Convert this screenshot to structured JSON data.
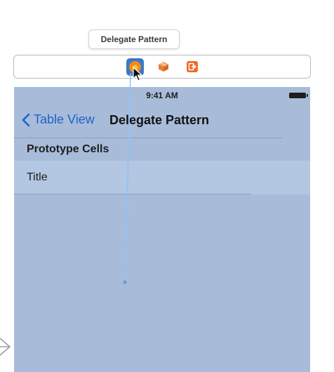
{
  "tooltip": {
    "text": "Delegate Pattern"
  },
  "dock": {
    "icons": [
      "view-controller-icon",
      "first-responder-icon",
      "exit-icon"
    ]
  },
  "status_bar": {
    "time": "9:41 AM"
  },
  "nav_bar": {
    "back_label": "Table View",
    "title": "Delegate Pattern"
  },
  "table": {
    "section_header": "Prototype Cells",
    "cell_title": "Title"
  },
  "colors": {
    "scene_background": "#a8bcd9",
    "cell_background": "#b3c6e2",
    "tint": "#1e63c8",
    "connection_line": "#8fc3f2",
    "view_controller_icon": "#3a78c9"
  }
}
